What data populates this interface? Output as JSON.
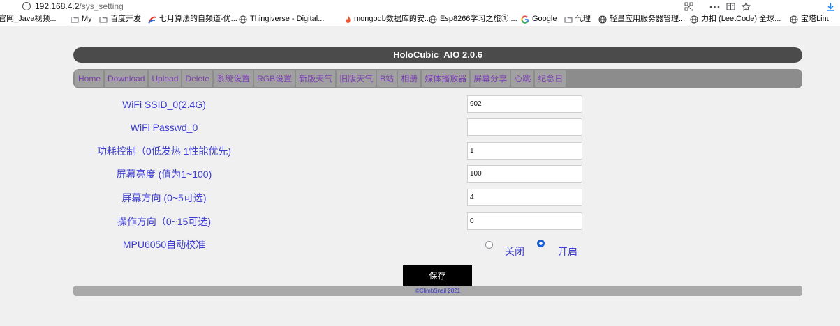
{
  "browser": {
    "url_host": "192.168.4.2",
    "url_path": "/sys_setting",
    "icons": [
      "info-icon",
      "qr-code-icon",
      "more-icon",
      "reader-mode-icon",
      "bookmark-star-icon",
      "download-icon"
    ]
  },
  "bookmarks": [
    {
      "label": "官网_Java视频...",
      "icon": ""
    },
    {
      "label": "My",
      "icon": "folder-icon"
    },
    {
      "label": "百度开发",
      "icon": "folder-icon"
    },
    {
      "label": "七月算法的自频道-优...",
      "icon": "site-icon"
    },
    {
      "label": "Thingiverse - Digital...",
      "icon": "globe-icon"
    },
    {
      "label": "mongodb数据库的安...",
      "icon": "flame-icon"
    },
    {
      "label": "Esp8266学习之旅① ...",
      "icon": "globe-icon"
    },
    {
      "label": "Google",
      "icon": "google-icon"
    },
    {
      "label": "代理",
      "icon": "folder-icon"
    },
    {
      "label": "轻量应用服务器管理...",
      "icon": "globe-icon"
    },
    {
      "label": "力扣 (LeetCode) 全球...",
      "icon": "globe-icon"
    },
    {
      "label": "宝塔Linux面",
      "icon": "globe-icon"
    }
  ],
  "header": {
    "title": "HoloCubic_AIO 2.0.6"
  },
  "nav": {
    "tabs": [
      "Home",
      "Download",
      "Upload",
      "Delete",
      "系统设置",
      "RGB设置",
      "新版天气",
      "旧版天气",
      "B站",
      "相册",
      "媒体播放器",
      "屏幕分享",
      "心跳",
      "纪念日"
    ]
  },
  "form": {
    "fields": [
      {
        "label": "WiFi SSID_0(2.4G)",
        "value": "902"
      },
      {
        "label": "WiFi Passwd_0",
        "value": ""
      },
      {
        "label": "功耗控制（0低发热 1性能优先)",
        "value": "1"
      },
      {
        "label": "屏幕亮度 (值为1~100)",
        "value": "100"
      },
      {
        "label": "屏幕方向 (0~5可选)",
        "value": "4"
      },
      {
        "label": "操作方向（0~15可选)",
        "value": "0"
      }
    ],
    "mpu_calibration": {
      "label": "MPU6050自动校准",
      "options": [
        {
          "label": "关闭",
          "checked": false
        },
        {
          "label": "开启",
          "checked": true
        }
      ]
    },
    "save_label": "保存"
  },
  "footer": {
    "copyright": "©ClimbSnail 2021"
  },
  "colors": {
    "title_bar": "#4b4b4b",
    "nav_bar": "#8c8c8c",
    "tab_text": "#7b3db5",
    "label_text": "#3d3dcf",
    "save_button": "#000000",
    "download_icon": "#0a84ff"
  }
}
